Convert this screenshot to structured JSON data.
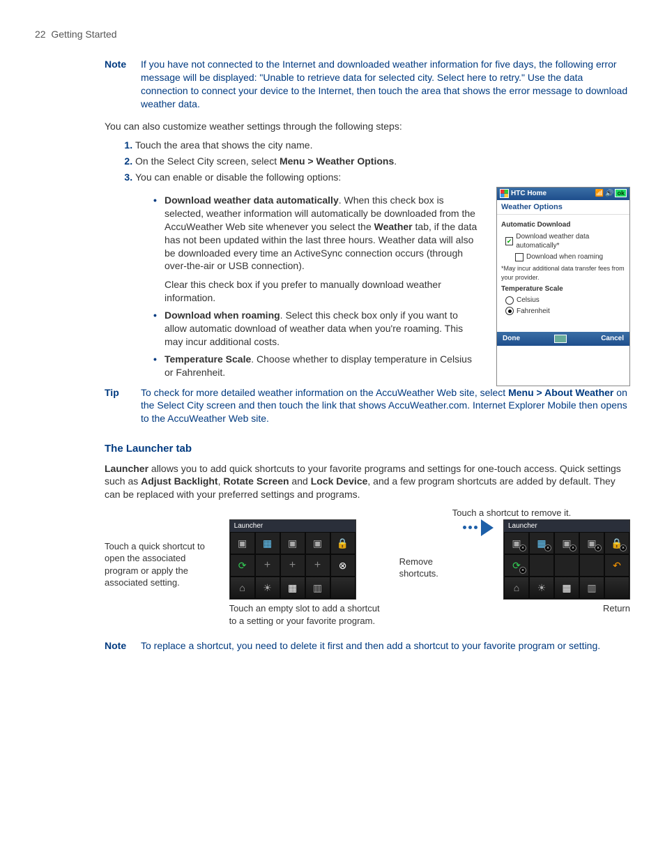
{
  "header": {
    "page_number": "22",
    "section": "Getting Started"
  },
  "note1": {
    "label": "Note",
    "text": "If you have not connected to the Internet and downloaded weather information for five days, the following error message will be displayed: \"Unable to retrieve data for selected city. Select here to retry.\" Use the data connection to connect your device to the Internet, then touch the area that shows the error message to download weather data."
  },
  "intro": "You can also customize weather settings through the following steps:",
  "steps": {
    "s1": "Touch the area that shows the city name.",
    "s2_pre": "On the Select City screen, select ",
    "s2_path": "Menu > Weather Options",
    "s2_post": ".",
    "s3": "You can enable or disable the following options:"
  },
  "bullet1": {
    "title": "Download weather data automatically",
    "text_a": ". When this check box is selected, weather information will automatically be downloaded from the AccuWeather Web site whenever you select the ",
    "tab_label": "Weather",
    "text_b": " tab, if the data has not been updated within the last three hours. Weather data will also be downloaded every time an ActiveSync connection occurs (through over-the-air or USB connection).",
    "text_c": "Clear this check box if you prefer to manually download weather information."
  },
  "bullet2": {
    "title": "Download when roaming",
    "text": ". Select this check box only if you want to allow automatic download of weather data when you're roaming. This may incur additional costs."
  },
  "bullet3": {
    "title": "Temperature Scale",
    "text": ". Choose whether to display temperature in Celsius or Fahrenheit."
  },
  "tip": {
    "label": "Tip",
    "text_a": "To check for more detailed weather information on the AccuWeather Web site, select ",
    "path": "Menu > About Weather",
    "text_b": " on the Select City screen and then touch the link that shows AccuWeather.com. Internet Explorer Mobile then opens to the AccuWeather Web site."
  },
  "launcher": {
    "heading": "The Launcher tab",
    "para_a": "Launcher",
    "para_b": " allows you to add quick shortcuts to your favorite programs and settings for one-touch access. Quick settings such as ",
    "q1": "Adjust Backlight",
    "sep1": ", ",
    "q2": "Rotate Screen",
    "sep2": " and ",
    "q3": "Lock Device",
    "para_c": ", and a few program shortcuts are added by default. They can be replaced with your preferred settings and programs."
  },
  "fig": {
    "callout_top": "Touch a shortcut to remove it.",
    "callout_left": "Touch a quick shortcut to open the associated program or apply the associated setting.",
    "callout_mid": "Remove shortcuts.",
    "callout_under_left": "Touch an empty slot to add a shortcut to a setting or your favorite program.",
    "callout_right": "Return",
    "panel_title": "Launcher"
  },
  "note2": {
    "label": "Note",
    "text": "To replace a shortcut, you need to delete it first and then add a shortcut to your favorite program or setting."
  },
  "phone": {
    "title": "HTC Home",
    "ok": "ok",
    "subtitle": "Weather Options",
    "sec1": "Automatic Download",
    "chk1": "Download weather data automatically*",
    "chk2": "Download when roaming",
    "footnote": "*May incur additional data transfer fees from your provider.",
    "sec2": "Temperature Scale",
    "r1": "Celsius",
    "r2": "Fahrenheit",
    "done": "Done",
    "cancel": "Cancel"
  }
}
